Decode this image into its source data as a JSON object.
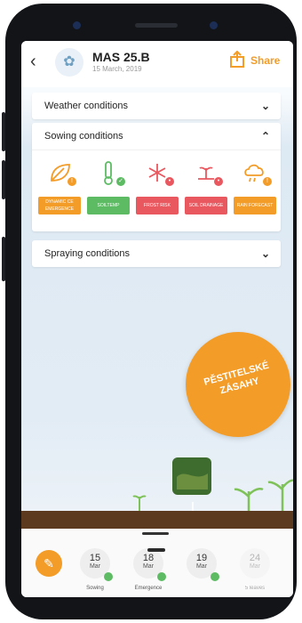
{
  "header": {
    "title": "MAS 25.B",
    "date": "15 March, 2019",
    "share_label": "Share"
  },
  "sections": [
    {
      "label": "Weather conditions",
      "state": "collapsed"
    },
    {
      "label": "Sowing conditions",
      "state": "expanded"
    },
    {
      "label": "Spraying conditions",
      "state": "collapsed"
    }
  ],
  "sowing_conditions": [
    {
      "label": "DYNAMIC CE EMERGENCE",
      "color": "#f39c28",
      "icon": "leaf-warning-icon"
    },
    {
      "label": "SOILTEMP",
      "color": "#5dbb63",
      "icon": "thermometer-icon"
    },
    {
      "label": "FROST RISK",
      "color": "#e9575f",
      "icon": "snowflake-icon"
    },
    {
      "label": "SOIL DRAINAGE",
      "color": "#e9575f",
      "icon": "seedling-drainage-icon"
    },
    {
      "label": "RAIN FORECAST",
      "color": "#f39c28",
      "icon": "rain-cloud-warning-icon"
    }
  ],
  "promo": {
    "line1": "PĚSTITELSKÉ",
    "line2": "ZÁSAHY"
  },
  "timeline": {
    "days": [
      {
        "num": "15",
        "mon": "Mar",
        "done": true
      },
      {
        "num": "18",
        "mon": "Mar",
        "done": true
      },
      {
        "num": "19",
        "mon": "Mar",
        "done": true
      },
      {
        "num": "24",
        "mon": "Mar",
        "done": false
      }
    ],
    "stages": [
      "Sowing",
      "Emergence",
      "",
      "5 leaves"
    ]
  },
  "colors": {
    "accent": "#f39c28",
    "ok": "#5dbb63",
    "risk": "#e9575f",
    "soil": "#5b3a20"
  }
}
